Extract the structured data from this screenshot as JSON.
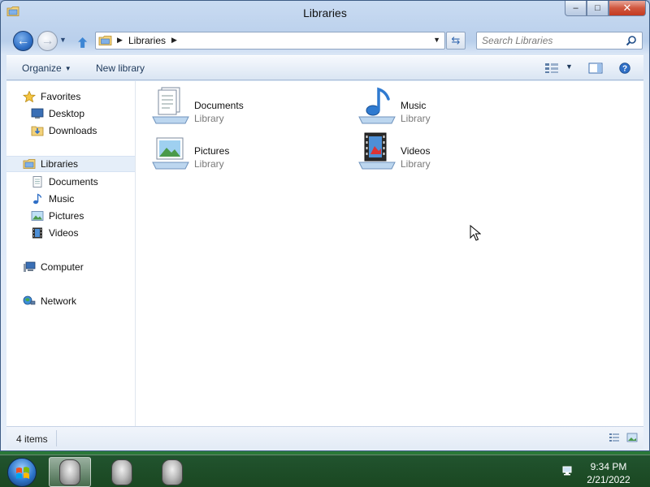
{
  "window": {
    "title": "Libraries",
    "icon": "libraries-folder-icon",
    "controls": {
      "minimize": "minimize-icon",
      "maximize": "maximize-icon",
      "close": "close-icon"
    }
  },
  "address": {
    "crumbs": [
      "Libraries"
    ],
    "search_placeholder": "Search Libraries"
  },
  "toolbar": {
    "organize_label": "Organize",
    "new_library_label": "New library"
  },
  "sidebar": {
    "favorites": {
      "label": "Favorites",
      "items": [
        {
          "label": "Desktop"
        },
        {
          "label": "Downloads"
        }
      ]
    },
    "libraries": {
      "label": "Libraries",
      "selected": true,
      "items": [
        {
          "label": "Documents"
        },
        {
          "label": "Music"
        },
        {
          "label": "Pictures"
        },
        {
          "label": "Videos"
        }
      ]
    },
    "computer": {
      "label": "Computer"
    },
    "network": {
      "label": "Network"
    }
  },
  "libraries": [
    {
      "name": "Documents",
      "type": "Library",
      "icon": "documents-library-icon"
    },
    {
      "name": "Music",
      "type": "Library",
      "icon": "music-library-icon"
    },
    {
      "name": "Pictures",
      "type": "Library",
      "icon": "pictures-library-icon"
    },
    {
      "name": "Videos",
      "type": "Library",
      "icon": "videos-library-icon"
    }
  ],
  "status": {
    "item_count": "4 items"
  },
  "taskbar": {
    "start": "windows-start-orb",
    "clock_time": "9:34 PM",
    "clock_date": "2/21/2022"
  },
  "colors": {
    "accent": "#2f6fc6",
    "window_frame": "#c9dbf2",
    "selection": "#e5eef9",
    "close_button": "#c43a21"
  }
}
